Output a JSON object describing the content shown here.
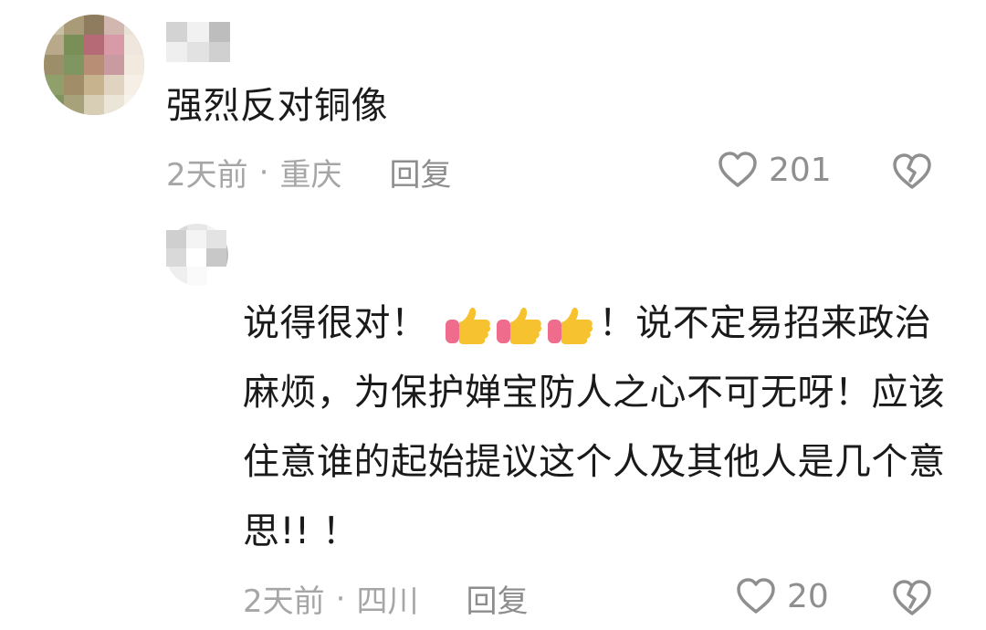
{
  "comment": {
    "username": "",
    "text": "强烈反对铜像",
    "time": "2天前",
    "location": "重庆",
    "separator": "·",
    "reply_label": "回复",
    "likes": "201"
  },
  "reply": {
    "username": "",
    "text_part1": "说得很对！",
    "text_part2": "！说不定易招来政治麻烦，为保护婵宝防人之心不可无呀！应该住意谁的起始提议这个人及其他人是几个意思!!  ！",
    "emoji": [
      "thumbs-up",
      "thumbs-up",
      "thumbs-up"
    ],
    "time": "2天前",
    "location": "四川",
    "separator": "·",
    "reply_label": "回复",
    "likes": "20"
  },
  "colors": {
    "meta": "#a6a6a6",
    "text": "#1a1a1a",
    "icon": "#8f8f8f",
    "thumb_yellow": "#f7c22f",
    "thumb_pink": "#f06c8d"
  },
  "icons": {
    "like": "heart-outline-icon",
    "dislike": "broken-heart-outline-icon"
  }
}
